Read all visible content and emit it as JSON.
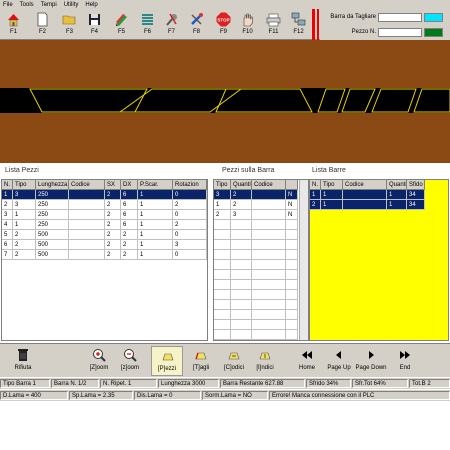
{
  "menu": [
    "File",
    "Tools",
    "Tempi",
    "Utility",
    "Help"
  ],
  "toolbar": {
    "buttons": [
      {
        "key": "F1",
        "icon": "home-icon"
      },
      {
        "key": "F2",
        "icon": "new-document-icon"
      },
      {
        "key": "F3",
        "icon": "open-folder-icon"
      },
      {
        "key": "F4",
        "icon": "save-disk-icon"
      },
      {
        "key": "F5",
        "icon": "pencil-tools-icon"
      },
      {
        "key": "F6",
        "icon": "stack-icon"
      },
      {
        "key": "F7",
        "icon": "wrench-icon"
      },
      {
        "key": "F8",
        "icon": "tools-cross-icon"
      },
      {
        "key": "F9",
        "icon": "stop-sign-icon"
      },
      {
        "key": "F10",
        "icon": "hand-icon"
      },
      {
        "key": "F11",
        "icon": "printer-icon"
      },
      {
        "key": "F12",
        "icon": "network-icon"
      }
    ],
    "stop_text": "STOP"
  },
  "config": {
    "barra_label": "Barra da Tagliare",
    "pezzo_label": "Pezzo N.",
    "barra_color": "#00e5ff",
    "pezzo_color": "#007a1a"
  },
  "colors": {
    "bar_brown": "#8b4a13",
    "bar_black": "#000000",
    "cut_yellow": "#e6d200",
    "selection": "#0a246a",
    "yellow_panel": "#ffff00"
  },
  "sections": {
    "lista_pezzi": "Lista Pezzi",
    "pezzi_barra": "Pezzi sulla Barra",
    "lista_barre": "Lista Barre"
  },
  "lista_pezzi": {
    "columns": [
      "N.",
      "Tipo",
      "Lunghezza",
      "Codice",
      "SX",
      "DX",
      "P.Scar.",
      "Rotazion"
    ],
    "rows": [
      [
        "1",
        "3",
        "250",
        "",
        "2",
        "6",
        "1",
        "0"
      ],
      [
        "2",
        "3",
        "250",
        "",
        "2",
        "6",
        "1",
        "2"
      ],
      [
        "3",
        "1",
        "250",
        "",
        "2",
        "6",
        "1",
        "0"
      ],
      [
        "4",
        "1",
        "250",
        "",
        "2",
        "6",
        "1",
        "2"
      ],
      [
        "5",
        "2",
        "500",
        "",
        "2",
        "2",
        "1",
        "0"
      ],
      [
        "6",
        "2",
        "500",
        "",
        "2",
        "2",
        "1",
        "3"
      ],
      [
        "7",
        "2",
        "500",
        "",
        "2",
        "2",
        "1",
        "0"
      ]
    ]
  },
  "pezzi_barra": {
    "columns": [
      "Tipo",
      "Quantit",
      "Codice",
      ""
    ],
    "rows": [
      [
        "3",
        "2",
        "",
        "N"
      ],
      [
        "1",
        "2",
        "",
        "N"
      ],
      [
        "2",
        "3",
        "",
        "N"
      ]
    ]
  },
  "lista_barre": {
    "columns": [
      "N.",
      "Tipo",
      "Codice",
      "Quantit",
      "Sfido"
    ],
    "rows": [
      [
        "1",
        "1",
        "",
        "1",
        "34"
      ],
      [
        "2",
        "1",
        "",
        "1",
        "34"
      ]
    ]
  },
  "bottom_toolbar": {
    "buttons": [
      {
        "label": "Rifiuta",
        "icon": "trash-icon"
      },
      {
        "label": "[Z]oom",
        "icon": "zoom-in-icon"
      },
      {
        "label": "[z]oom",
        "icon": "zoom-out-icon"
      },
      {
        "label": "[P]ezzi",
        "icon": "pieces-icon"
      },
      {
        "label": "[T]agli",
        "icon": "cuts-icon"
      },
      {
        "label": "[C]odici",
        "icon": "codes-icon"
      },
      {
        "label": "[I]ndici",
        "icon": "indexes-icon"
      },
      {
        "label": "Home",
        "icon": "home-arrow-icon"
      },
      {
        "label": "Page Up",
        "icon": "page-up-icon"
      },
      {
        "label": "Page Down",
        "icon": "page-down-icon"
      },
      {
        "label": "End",
        "icon": "end-arrow-icon"
      }
    ]
  },
  "status1": [
    "Tipo Barra 1",
    "Barra N. 1/2",
    "N. Ripet. 1",
    "Lunghezza 3000",
    "Barra Restante 627.88",
    "Sfrido 34%",
    "Sfr.Tot 64%",
    "Tot.B 2"
  ],
  "status2": [
    "D.Lama = 400",
    "Sp.Lama = 2.35",
    "Dis.Lama = 0",
    "Sorm.Lama = NO",
    "Errore! Manca connessione con il PLC"
  ]
}
